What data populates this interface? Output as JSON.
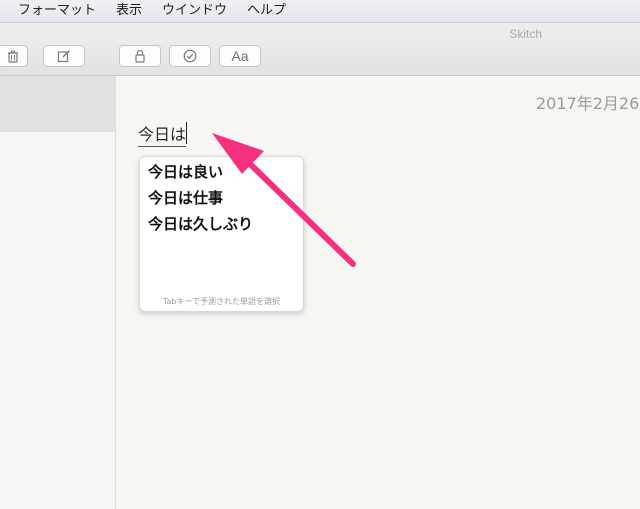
{
  "menubar": {
    "items": [
      "フォーマット",
      "表示",
      "ウインドウ",
      "ヘルプ"
    ]
  },
  "window": {
    "title": "Skitch"
  },
  "toolbar": {
    "font_label": "Aa",
    "icons": [
      "trash-icon",
      "compose-icon",
      "lock-icon",
      "checkmark-icon",
      "font-icon"
    ]
  },
  "note": {
    "date": "2017年2月26",
    "text": "今日は"
  },
  "autocomplete": {
    "suggestions": [
      "今日は良い",
      "今日は仕事",
      "今日は久しぶり"
    ],
    "hint": "Tabキーで予測された単語を選択"
  },
  "annotation": {
    "arrow_color": "#f5317f"
  }
}
